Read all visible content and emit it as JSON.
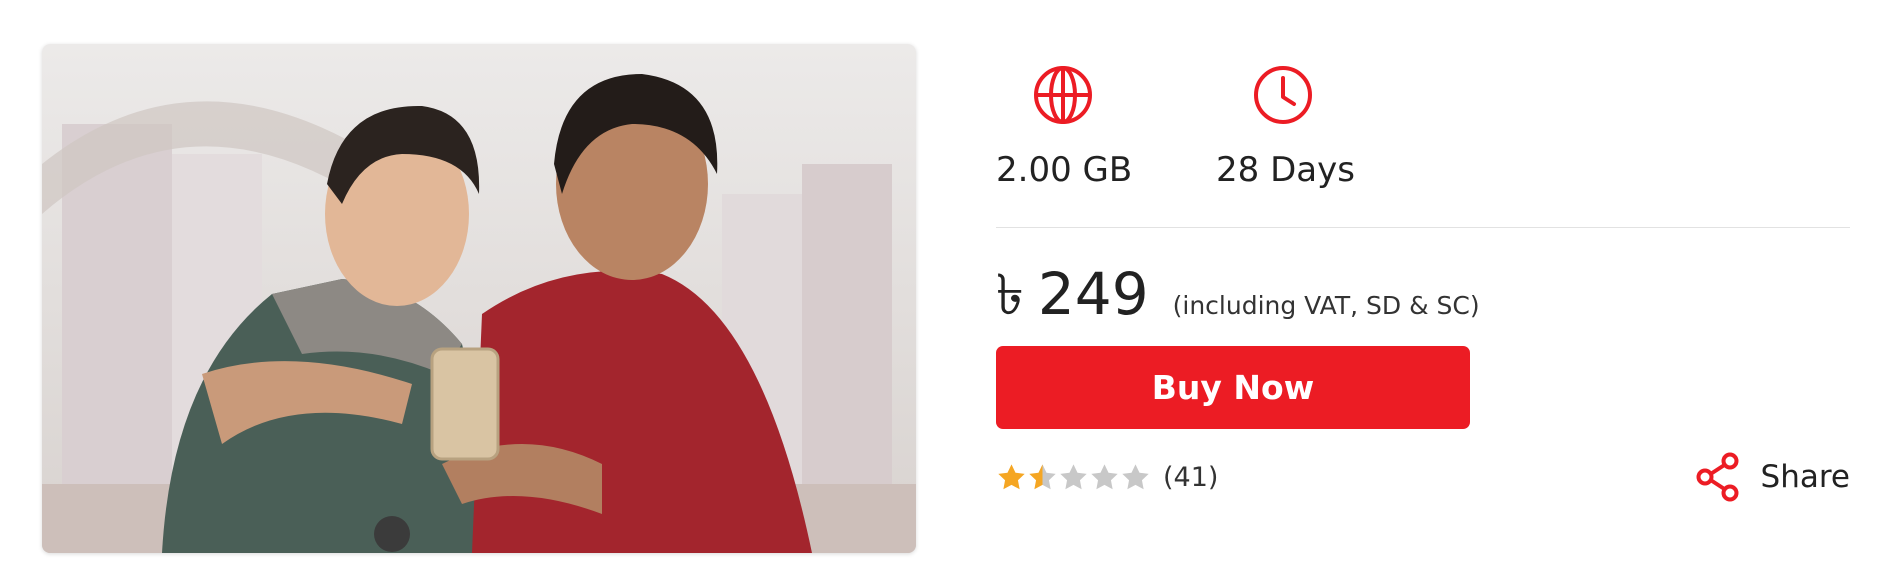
{
  "product": {
    "image_description": "",
    "features": [
      {
        "icon": "globe-icon",
        "value": "2.00 GB"
      },
      {
        "icon": "clock-icon",
        "value": "28 Days"
      }
    ],
    "currency_symbol": "৳",
    "price": "249",
    "price_note": "(including VAT, SD & SC)",
    "buy_label": "Buy Now",
    "rating": {
      "stars_filled": 1.5,
      "stars_total": 5,
      "count": "(41)"
    },
    "share_label": "Share"
  },
  "colors": {
    "accent": "#ec1c24",
    "star_filled": "#f5a623",
    "star_empty": "#c8c8c8",
    "text": "#222222"
  }
}
